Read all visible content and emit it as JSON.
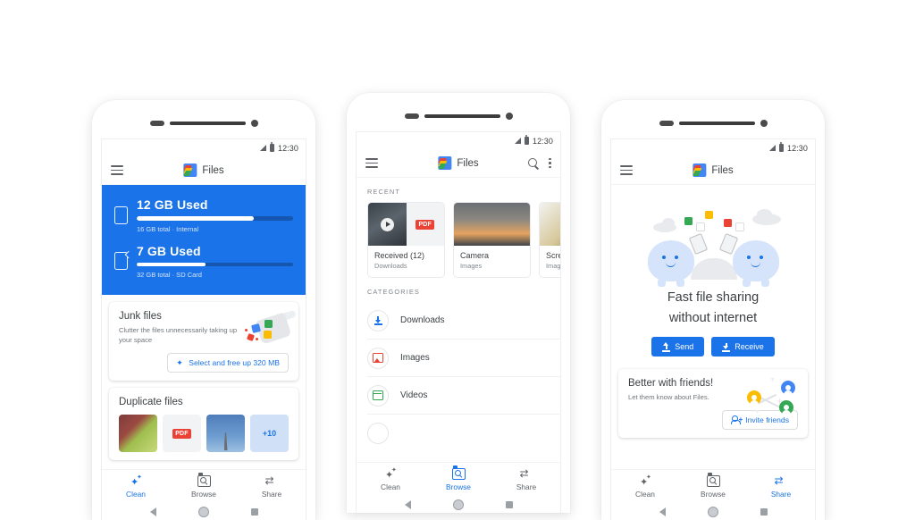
{
  "app": {
    "name": "Files",
    "logo_icon": "files-logo-icon"
  },
  "status_bar": {
    "time": "12:30",
    "signal_icon": "signal-icon",
    "battery_icon": "battery-icon"
  },
  "colors": {
    "accent": "#1a73e8",
    "storage_bg": "#1a73e8",
    "text_primary": "#3c4043",
    "text_secondary": "#80868b",
    "red": "#ea4335",
    "yellow": "#fbbc04",
    "green": "#34a853",
    "blue": "#4285f4"
  },
  "bottom_nav": {
    "items": [
      {
        "label": "Clean",
        "icon": "sparkle-icon"
      },
      {
        "label": "Browse",
        "icon": "folder-search-icon"
      },
      {
        "label": "Share",
        "icon": "share-arrows-icon"
      }
    ]
  },
  "system_nav": {
    "back_icon": "back-triangle-icon",
    "home_icon": "home-circle-icon",
    "recents_icon": "recents-square-icon"
  },
  "phone1": {
    "active_tab": "Clean",
    "menu_icon": "hamburger-menu-icon",
    "storage": [
      {
        "icon": "phone-storage-icon",
        "title": "12 GB Used",
        "subtitle": "16 GB total · Internal",
        "percent": 75
      },
      {
        "icon": "sd-card-icon",
        "title": "7 GB Used",
        "subtitle": "32 GB total · SD Card",
        "percent": 44
      }
    ],
    "junk_card": {
      "title": "Junk files",
      "subtitle": "Clutter the files unnecessarily taking up your space",
      "button_label": "Select and free up 320 MB",
      "button_icon": "sparkle-icon",
      "illustration": "dustpan-with-files-illustration"
    },
    "duplicate_card": {
      "title": "Duplicate files",
      "thumbs": [
        {
          "kind": "photo-grapes",
          "label": ""
        },
        {
          "kind": "pdf",
          "label": "PDF"
        },
        {
          "kind": "photo-tower",
          "label": ""
        },
        {
          "kind": "more",
          "label": "+10"
        }
      ]
    }
  },
  "phone2": {
    "active_tab": "Browse",
    "menu_icon": "hamburger-menu-icon",
    "search_icon": "search-icon",
    "overflow_icon": "more-vert-icon",
    "recent_label": "RECENT",
    "recent": [
      {
        "title": "Received (12)",
        "subtitle": "Downloads",
        "thumb": "video-and-pdf"
      },
      {
        "title": "Camera",
        "subtitle": "Images",
        "thumb": "sunset-clouds"
      },
      {
        "title": "Screenshots",
        "subtitle": "Images",
        "thumb": "food"
      }
    ],
    "categories_label": "CATEGORIES",
    "categories": [
      {
        "name": "Downloads",
        "icon": "download-icon"
      },
      {
        "name": "Images",
        "icon": "image-icon"
      },
      {
        "name": "Videos",
        "icon": "video-icon"
      }
    ]
  },
  "phone3": {
    "active_tab": "Share",
    "menu_icon": "hamburger-menu-icon",
    "hero": {
      "illustration": "two-blobs-sharing-files-illustration",
      "title_line1": "Fast file sharing",
      "title_line2": "without internet",
      "buttons": [
        {
          "label": "Send",
          "icon": "upload-icon"
        },
        {
          "label": "Receive",
          "icon": "download-icon"
        }
      ]
    },
    "friends_card": {
      "title": "Better with friends!",
      "subtitle": "Let them know about Files.",
      "button_label": "Invite friends",
      "button_icon": "person-add-icon",
      "illustration": "connected-avatars-illustration"
    }
  }
}
